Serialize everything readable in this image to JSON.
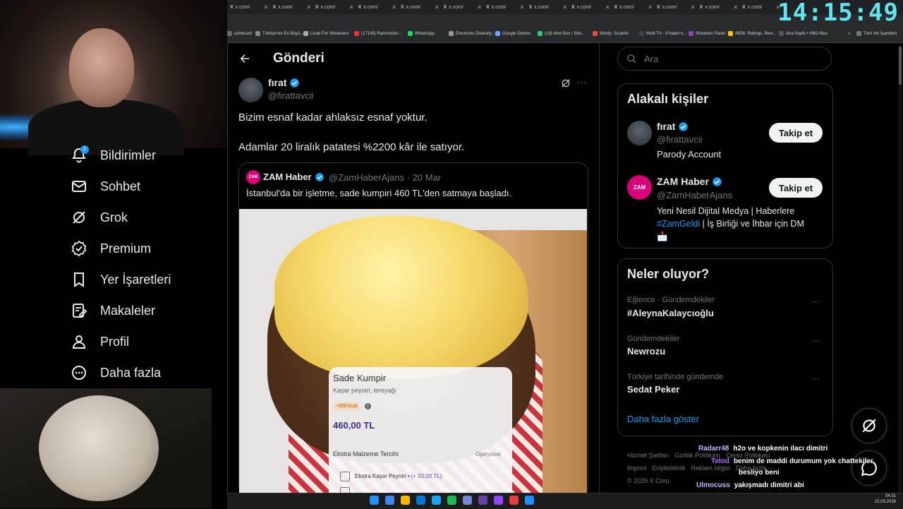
{
  "clock": "14:15:49",
  "browser": {
    "tab_label": "x.com/",
    "bookmarks": [
      {
        "label": "ashboard",
        "color": "#6a6a6a"
      },
      {
        "label": "Türkiye'nin En Büyü...",
        "color": "#888"
      },
      {
        "label": "Livad For Streamers",
        "color": "#aaa"
      },
      {
        "label": "(17145) Rammstein...",
        "color": "#e33"
      },
      {
        "label": "WhatsApp",
        "color": "#25d366"
      },
      {
        "label": "Electronic Diversity...",
        "color": "#999"
      },
      {
        "label": "Google Gemini",
        "color": "#6ea8fe"
      },
      {
        "label": "(19) Alert Box / Stre...",
        "color": "#2ecc71"
      },
      {
        "label": "Windy: Sıcaklık",
        "color": "#e74c3c"
      },
      {
        "label": "Multi TV - 6 haber k...",
        "color": "#444"
      },
      {
        "label": "Streamer Panel",
        "color": "#8e44ad"
      },
      {
        "label": "IMDb: Ratings, Revi...",
        "color": "#f5c518"
      },
      {
        "label": "Ana Sayfa • HBO Max",
        "color": "#555"
      },
      {
        "label": "»",
        "color": "transparent"
      },
      {
        "label": "Tüm Yer İşaretleri",
        "color": "#777"
      }
    ]
  },
  "nav": [
    {
      "label": "Bildirimler",
      "icon": "bell-icon"
    },
    {
      "label": "Sohbet",
      "icon": "mail-icon"
    },
    {
      "label": "Grok",
      "icon": "grok-icon"
    },
    {
      "label": "Premium",
      "icon": "premium-badge-icon"
    },
    {
      "label": "Yer İşaretleri",
      "icon": "bookmark-icon"
    },
    {
      "label": "Makaleler",
      "icon": "article-icon"
    },
    {
      "label": "Profil",
      "icon": "person-icon"
    },
    {
      "label": "Daha fazla",
      "icon": "more-circle-icon"
    }
  ],
  "nav_badge": "1",
  "header": {
    "title": "Gönderi"
  },
  "tweet": {
    "name": "fırat",
    "handle": "@firattavcii",
    "line1": "Bizim esnaf kadar ahlaksız esnaf yoktur.",
    "line2": "Adamlar 20 liralık patatesi %2200 kâr ile satıyor."
  },
  "quote": {
    "logo": "ZAM",
    "name": "ZAM Haber",
    "handle": "@ZamHaberAjans · 20 Mar",
    "text": "İstanbul'da bir işletme, sade kumpiri 460 TL'den satmaya başladı."
  },
  "menu_card": {
    "title": "Sade Kumpir",
    "subtitle": "Kaşar peyniri, tereyağı",
    "kcal": "~650 kcal",
    "info": "i",
    "price": "460,00 TL",
    "section": "Ekstra Malzeme Tercihi",
    "optional": "Opsiyonel",
    "extra_label": "Ekstra Kaşar Peyniri • ",
    "extra_price": "(+ 20,00 TL)"
  },
  "search": {
    "placeholder": "Ara"
  },
  "related": {
    "title": "Alakalı kişiler",
    "people": [
      {
        "name": "fırat",
        "handle": "@firattavcii",
        "bio": "Parody Account",
        "follow": "Takip et"
      },
      {
        "name": "ZAM Haber",
        "handle": "@ZamHaberAjans",
        "bio_line1": "Yeni Nesil Dijital Medya | Haberlere",
        "bio_tag": "#ZamGeldi",
        "bio_line2": " | İş Birliği ve İhbar için DM",
        "bio_emoji": "📩",
        "follow": "Takip et",
        "logo": "ZAM"
      }
    ]
  },
  "trends": {
    "title": "Neler oluyor?",
    "items": [
      {
        "category": "Eğlence · Gündemdekiler",
        "name": "#AleynaKalaycıoğlu"
      },
      {
        "category": "Gündemdekiler",
        "name": "Newrozu"
      },
      {
        "category": "Türkiye tarihinde gündemde",
        "name": "Sedat Peker"
      }
    ],
    "more": "Daha fazla göster",
    "more_icon": "···"
  },
  "footer": {
    "links": [
      "Hizmet Şartları",
      "Gizlilik Politikası",
      "Çerez Politikası",
      "Imprint",
      "Erişilebilirlik",
      "Reklam bilgisi",
      "Daha fazla ···"
    ],
    "copyright": "© 2026 X Corp."
  },
  "chat": [
    {
      "user": "Radarr48",
      "color": "#c9b3ff",
      "msg": "h2o ve kopkenin ilacı dimitri"
    },
    {
      "user": "Telod",
      "color": "#b06cff",
      "msg": "benim de maddi durumum yok chattekiler"
    },
    {
      "user": "",
      "color": "#fff",
      "msg": "besliyo beni"
    },
    {
      "user": "Ulmocuss",
      "color": "#c9b3ff",
      "msg": "yakışmadı dimitri abi"
    },
    {
      "user": "Telod",
      "color": "#b06cff",
      "msg": ""
    }
  ],
  "taskbar": {
    "time": "04:31",
    "date": "22.03.2026"
  },
  "colors": {
    "accent": "#1d9bf0",
    "verified": "#1d9bf0",
    "zam_brand": "#d9007a"
  }
}
